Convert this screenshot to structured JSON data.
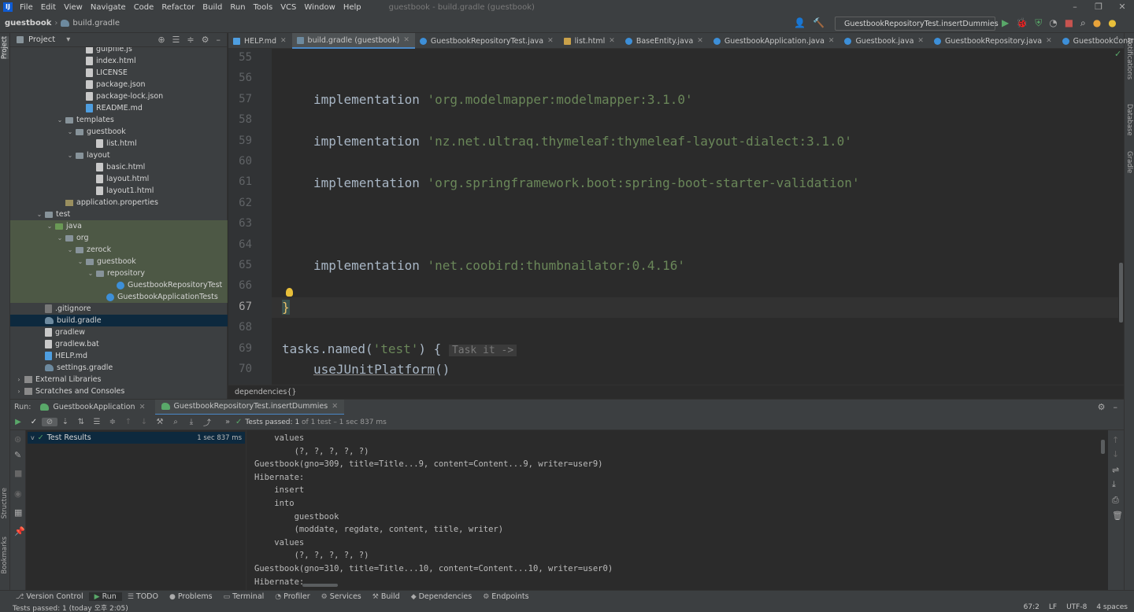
{
  "menubar": {
    "logo": "IJ",
    "items": [
      "File",
      "Edit",
      "View",
      "Navigate",
      "Code",
      "Refactor",
      "Build",
      "Run",
      "Tools",
      "VCS",
      "Window",
      "Help"
    ],
    "window_title": "guestbook - build.gradle (guestbook)"
  },
  "navbar": {
    "project": "guestbook",
    "file": "build.gradle",
    "run_config": "GuestbookRepositoryTest.insertDummies"
  },
  "left_strip": {
    "project_label": "Project",
    "structure_label": "Structure",
    "bookmarks_label": "Bookmarks"
  },
  "right_strip": {
    "notifications_label": "Notifications",
    "database_label": "Database",
    "gradle_label": "Gradle"
  },
  "project_panel": {
    "title": "Project",
    "tree": [
      {
        "label": "gulpfile.js",
        "indent": 6,
        "icon": "js",
        "arrow": ""
      },
      {
        "label": "index.html",
        "indent": 6,
        "icon": "file",
        "arrow": ""
      },
      {
        "label": "LICENSE",
        "indent": 6,
        "icon": "file",
        "arrow": ""
      },
      {
        "label": "package.json",
        "indent": 6,
        "icon": "file",
        "arrow": ""
      },
      {
        "label": "package-lock.json",
        "indent": 6,
        "icon": "file",
        "arrow": ""
      },
      {
        "label": "README.md",
        "indent": 6,
        "icon": "md",
        "arrow": ""
      },
      {
        "label": "templates",
        "indent": 4,
        "icon": "folder",
        "arrow": "v"
      },
      {
        "label": "guestbook",
        "indent": 5,
        "icon": "folder",
        "arrow": "v"
      },
      {
        "label": "list.html",
        "indent": 7,
        "icon": "file",
        "arrow": ""
      },
      {
        "label": "layout",
        "indent": 5,
        "icon": "folder",
        "arrow": "v"
      },
      {
        "label": "basic.html",
        "indent": 7,
        "icon": "file",
        "arrow": ""
      },
      {
        "label": "layout.html",
        "indent": 7,
        "icon": "file",
        "arrow": ""
      },
      {
        "label": "layout1.html",
        "indent": 7,
        "icon": "file",
        "arrow": ""
      },
      {
        "label": "application.properties",
        "indent": 4,
        "icon": "res",
        "arrow": ""
      },
      {
        "label": "test",
        "indent": 2,
        "icon": "folder",
        "arrow": "v"
      },
      {
        "label": "java",
        "indent": 3,
        "icon": "green",
        "arrow": "v",
        "hl": true
      },
      {
        "label": "org",
        "indent": 4,
        "icon": "folder",
        "arrow": "v",
        "hl": true
      },
      {
        "label": "zerock",
        "indent": 5,
        "icon": "folder",
        "arrow": "v",
        "hl": true
      },
      {
        "label": "guestbook",
        "indent": 6,
        "icon": "folder",
        "arrow": "v",
        "hl": true
      },
      {
        "label": "repository",
        "indent": 7,
        "icon": "folder",
        "arrow": "v",
        "hl": true
      },
      {
        "label": "GuestbookRepositoryTest",
        "indent": 9,
        "icon": "class",
        "arrow": "",
        "hl": true
      },
      {
        "label": "GuestbookApplicationTests",
        "indent": 8,
        "icon": "class",
        "arrow": "",
        "hl": true
      },
      {
        "label": ".gitignore",
        "indent": 2,
        "icon": "git",
        "arrow": ""
      },
      {
        "label": "build.gradle",
        "indent": 2,
        "icon": "gradle",
        "arrow": "",
        "sel": true
      },
      {
        "label": "gradlew",
        "indent": 2,
        "icon": "file",
        "arrow": ""
      },
      {
        "label": "gradlew.bat",
        "indent": 2,
        "icon": "file",
        "arrow": ""
      },
      {
        "label": "HELP.md",
        "indent": 2,
        "icon": "md",
        "arrow": ""
      },
      {
        "label": "settings.gradle",
        "indent": 2,
        "icon": "gradle",
        "arrow": ""
      },
      {
        "label": "External Libraries",
        "indent": 0,
        "icon": "lib",
        "arrow": ">"
      },
      {
        "label": "Scratches and Consoles",
        "indent": 0,
        "icon": "lib",
        "arrow": ">"
      }
    ]
  },
  "editor_tabs": [
    {
      "label": "HELP.md",
      "color": "#4e9ee0",
      "active": false
    },
    {
      "label": "build.gradle (guestbook)",
      "color": "#6d8a9f",
      "active": true
    },
    {
      "label": "GuestbookRepositoryTest.java",
      "color": "#3d8fd8",
      "active": false
    },
    {
      "label": "list.html",
      "color": "#c9a14a",
      "active": false
    },
    {
      "label": "BaseEntity.java",
      "color": "#3d8fd8",
      "active": false
    },
    {
      "label": "GuestbookApplication.java",
      "color": "#3d8fd8",
      "active": false
    },
    {
      "label": "Guestbook.java",
      "color": "#3d8fd8",
      "active": false
    },
    {
      "label": "GuestbookRepository.java",
      "color": "#3d8fd8",
      "active": false
    },
    {
      "label": "GuestbookController.java",
      "color": "#3d8fd8",
      "active": false
    }
  ],
  "editor": {
    "line_numbers": [
      "55",
      "56",
      "57",
      "58",
      "59",
      "60",
      "61",
      "62",
      "63",
      "64",
      "65",
      "66",
      "67",
      "68",
      "69",
      "70"
    ],
    "current_line": "67",
    "line57_kw": "implementation",
    "line57_str": "'org.modelmapper:modelmapper:3.1.0'",
    "line59_kw": "implementation",
    "line59_str": "'nz.net.ultraq.thymeleaf:thymeleaf-layout-dialect:3.1.0'",
    "line61_kw": "implementation",
    "line61_str": "'org.springframework.boot:spring-boot-starter-validation'",
    "line65_kw": "implementation",
    "line65_str": "'net.coobird:thumbnailator:0.4.16'",
    "line67": "}",
    "line69_a": "tasks.named(",
    "line69_str": "'test'",
    "line69_b": ") {",
    "line69_hint": "Task it ->",
    "line70": "useJUnitPlatform",
    "line70_paren": "()"
  },
  "breadcrumb": "dependencies{}",
  "run_panel": {
    "label": "Run:",
    "tabs": [
      {
        "label": "GuestbookApplication",
        "active": false
      },
      {
        "label": "GuestbookRepositoryTest.insertDummies",
        "active": true
      }
    ],
    "status_prefix": "Tests passed:",
    "status_count": "1",
    "status_detail": "of 1 test – 1 sec 837 ms",
    "test_results_label": "Test Results",
    "test_results_time": "1 sec 837 ms",
    "console_lines": [
      {
        "text": "    values",
        "color": "#bbbbbb"
      },
      {
        "text": "        (?, ?, ?, ?, ?)",
        "color": "#bbbbbb"
      },
      {
        "text": "Guestbook(gno=309, title=Title...9, content=Content...9, writer=user9)",
        "color": "#bbbbbb"
      },
      {
        "text": "Hibernate: ",
        "color": "#bbbbbb"
      },
      {
        "text": "    insert ",
        "color": "#bbbbbb"
      },
      {
        "text": "    into",
        "color": "#bbbbbb"
      },
      {
        "text": "        guestbook",
        "color": "#bbbbbb"
      },
      {
        "text": "        (moddate, regdate, content, title, writer) ",
        "color": "#bbbbbb"
      },
      {
        "text": "    values",
        "color": "#bbbbbb"
      },
      {
        "text": "        (?, ?, ?, ?, ?)",
        "color": "#bbbbbb"
      },
      {
        "text": "Guestbook(gno=310, title=Title...10, content=Content...10, writer=user0)",
        "color": "#bbbbbb"
      },
      {
        "text": "Hibernate: ",
        "color": "#bbbbbb"
      }
    ]
  },
  "status_tabs": [
    "Version Control",
    "Run",
    "TODO",
    "Problems",
    "Terminal",
    "Profiler",
    "Services",
    "Build",
    "Dependencies",
    "Endpoints"
  ],
  "status_line": {
    "message": "Tests passed: 1 (today 오후 2:05)",
    "position": "67:2",
    "line_sep": "LF",
    "encoding": "UTF-8",
    "indent": "4 spaces"
  }
}
